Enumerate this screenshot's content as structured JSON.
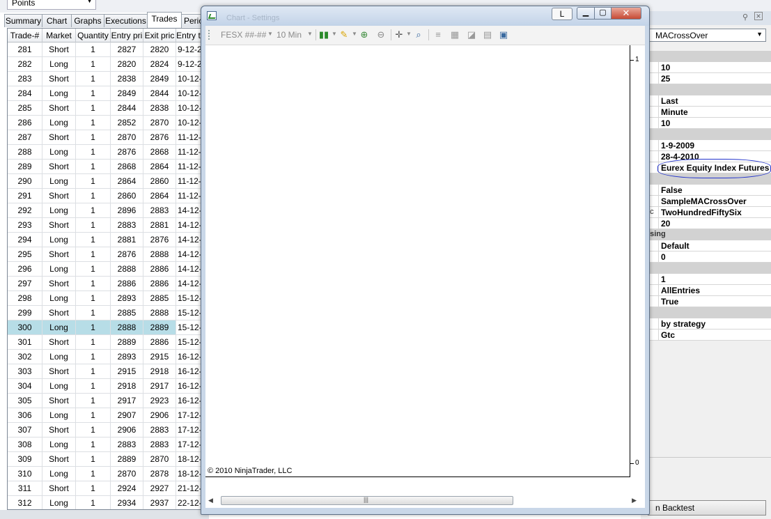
{
  "units_combo": {
    "value": "Points"
  },
  "tabs": [
    {
      "label": "Summary"
    },
    {
      "label": "Chart"
    },
    {
      "label": "Graphs"
    },
    {
      "label": "Executions"
    },
    {
      "label": "Trades"
    },
    {
      "label": "Perio"
    }
  ],
  "trades_grid": {
    "columns": [
      "Trade-#",
      "Market",
      "Quantity",
      "Entry pri",
      "Exit pric",
      "Entry t"
    ],
    "rows": [
      [
        "281",
        "Short",
        "1",
        "2827",
        "2820",
        "9-12-2"
      ],
      [
        "282",
        "Long",
        "1",
        "2820",
        "2824",
        "9-12-2"
      ],
      [
        "283",
        "Short",
        "1",
        "2838",
        "2849",
        "10-12-"
      ],
      [
        "284",
        "Long",
        "1",
        "2849",
        "2844",
        "10-12-"
      ],
      [
        "285",
        "Short",
        "1",
        "2844",
        "2838",
        "10-12-"
      ],
      [
        "286",
        "Long",
        "1",
        "2852",
        "2870",
        "10-12-"
      ],
      [
        "287",
        "Short",
        "1",
        "2870",
        "2876",
        "11-12-"
      ],
      [
        "288",
        "Long",
        "1",
        "2876",
        "2868",
        "11-12-"
      ],
      [
        "289",
        "Short",
        "1",
        "2868",
        "2864",
        "11-12-"
      ],
      [
        "290",
        "Long",
        "1",
        "2864",
        "2860",
        "11-12-"
      ],
      [
        "291",
        "Short",
        "1",
        "2860",
        "2864",
        "11-12-"
      ],
      [
        "292",
        "Long",
        "1",
        "2896",
        "2883",
        "14-12-"
      ],
      [
        "293",
        "Short",
        "1",
        "2883",
        "2881",
        "14-12-"
      ],
      [
        "294",
        "Long",
        "1",
        "2881",
        "2876",
        "14-12-"
      ],
      [
        "295",
        "Short",
        "1",
        "2876",
        "2888",
        "14-12-"
      ],
      [
        "296",
        "Long",
        "1",
        "2888",
        "2886",
        "14-12-"
      ],
      [
        "297",
        "Short",
        "1",
        "2886",
        "2886",
        "14-12-"
      ],
      [
        "298",
        "Long",
        "1",
        "2893",
        "2885",
        "15-12-"
      ],
      [
        "299",
        "Short",
        "1",
        "2885",
        "2888",
        "15-12-"
      ],
      [
        "300",
        "Long",
        "1",
        "2888",
        "2889",
        "15-12-"
      ],
      [
        "301",
        "Short",
        "1",
        "2889",
        "2886",
        "15-12-"
      ],
      [
        "302",
        "Long",
        "1",
        "2893",
        "2915",
        "16-12-"
      ],
      [
        "303",
        "Short",
        "1",
        "2915",
        "2918",
        "16-12-"
      ],
      [
        "304",
        "Long",
        "1",
        "2918",
        "2917",
        "16-12-"
      ],
      [
        "305",
        "Short",
        "1",
        "2917",
        "2923",
        "16-12-"
      ],
      [
        "306",
        "Long",
        "1",
        "2907",
        "2906",
        "17-12-"
      ],
      [
        "307",
        "Short",
        "1",
        "2906",
        "2883",
        "17-12-"
      ],
      [
        "308",
        "Long",
        "1",
        "2883",
        "2883",
        "17-12-"
      ],
      [
        "309",
        "Short",
        "1",
        "2889",
        "2870",
        "18-12-"
      ],
      [
        "310",
        "Long",
        "1",
        "2870",
        "2878",
        "18-12-"
      ],
      [
        "311",
        "Short",
        "1",
        "2924",
        "2927",
        "21-12-"
      ],
      [
        "312",
        "Long",
        "1",
        "2934",
        "2937",
        "22-12-"
      ]
    ],
    "selected_trade": "300"
  },
  "chart_window": {
    "ghost_title": "Chart - Settings",
    "l_button": "L",
    "toolbar": {
      "instrument": "FESX ##-##",
      "interval": "10 Min"
    },
    "y_axis_top": "1",
    "y_axis_bottom": "0",
    "copyright": "© 2010 NinjaTrader, LLC"
  },
  "properties": {
    "strategy_combo": "MACrossOver",
    "rows": [
      {
        "type": "cat",
        "value": ""
      },
      {
        "type": "val",
        "value": "10"
      },
      {
        "type": "val",
        "value": "25"
      },
      {
        "type": "cat",
        "value": ""
      },
      {
        "type": "val",
        "value": "Last"
      },
      {
        "type": "val",
        "value": "Minute"
      },
      {
        "type": "val",
        "value": "10"
      },
      {
        "type": "cat",
        "value": ""
      },
      {
        "type": "val",
        "value": "1-9-2009"
      },
      {
        "type": "val",
        "value": "28-4-2010"
      },
      {
        "type": "val",
        "value": "Eurex Equity Index Futures"
      },
      {
        "type": "cat",
        "value": ""
      },
      {
        "type": "val",
        "value": "False"
      },
      {
        "type": "val",
        "value": "SampleMACrossOver"
      },
      {
        "type": "val",
        "value": "TwoHundredFiftySix",
        "label": "ac"
      },
      {
        "type": "val",
        "value": "20"
      },
      {
        "type": "cat",
        "value": "",
        "label": "ssing"
      },
      {
        "type": "val",
        "value": "Default"
      },
      {
        "type": "val",
        "value": "0"
      },
      {
        "type": "cat",
        "value": ""
      },
      {
        "type": "val",
        "value": "1"
      },
      {
        "type": "val",
        "value": "AllEntries"
      },
      {
        "type": "val",
        "value": "True"
      },
      {
        "type": "cat",
        "value": ""
      },
      {
        "type": "val",
        "value": "by strategy"
      },
      {
        "type": "val",
        "value": "Gtc"
      }
    ],
    "backtest_button": "n Backtest"
  },
  "colors": {
    "selected_row": "#b7dde7",
    "annotation": "#2233cc",
    "close_button": "#c74a34"
  }
}
